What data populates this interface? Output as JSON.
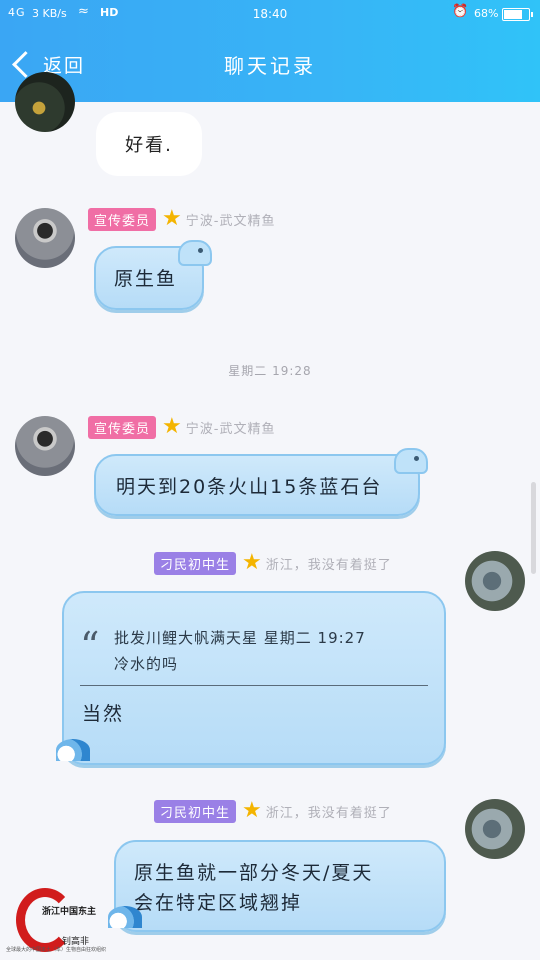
{
  "status_bar": {
    "signal": "4G",
    "speed": "3 KB/s",
    "hd": "HD",
    "time": "18:40",
    "battery": "68%",
    "battery_level": 0.68
  },
  "header": {
    "back_label": "返回",
    "title": "聊天记录"
  },
  "messages": {
    "m1": {
      "text": "好看."
    },
    "m2": {
      "badge": "宣传委员",
      "location": "宁波-武文精鱼",
      "text": "原生鱼"
    },
    "timestamp1": "星期二 19:28",
    "m3": {
      "badge": "宣传委员",
      "location": "宁波-武文精鱼",
      "text": "明天到20条火山15条蓝石台"
    },
    "m4": {
      "badge": "刁民初中生",
      "location": "浙江，我没有着挺了",
      "quote_line1": "批发川鲤大帆满天星 星期二 19:27",
      "quote_line2": "冷水的吗",
      "text": "当然"
    },
    "m5": {
      "badge": "刁民初中生",
      "location": "浙江，我没有着挺了",
      "line1": "原生鱼就一部分冬天/夏天",
      "line2": "会在特定区域翘掉"
    }
  },
  "watermark": {
    "line1": "浙江中国东主",
    "line2": "钊高非",
    "line3": "全球最大的中国本土（本）生物自由狂欢组织"
  },
  "colors": {
    "header_blue": "#38b4f6",
    "badge_pink": "#f06ea5",
    "badge_purple": "#9a80e6",
    "bubble_blue": "#c3e3f9"
  }
}
